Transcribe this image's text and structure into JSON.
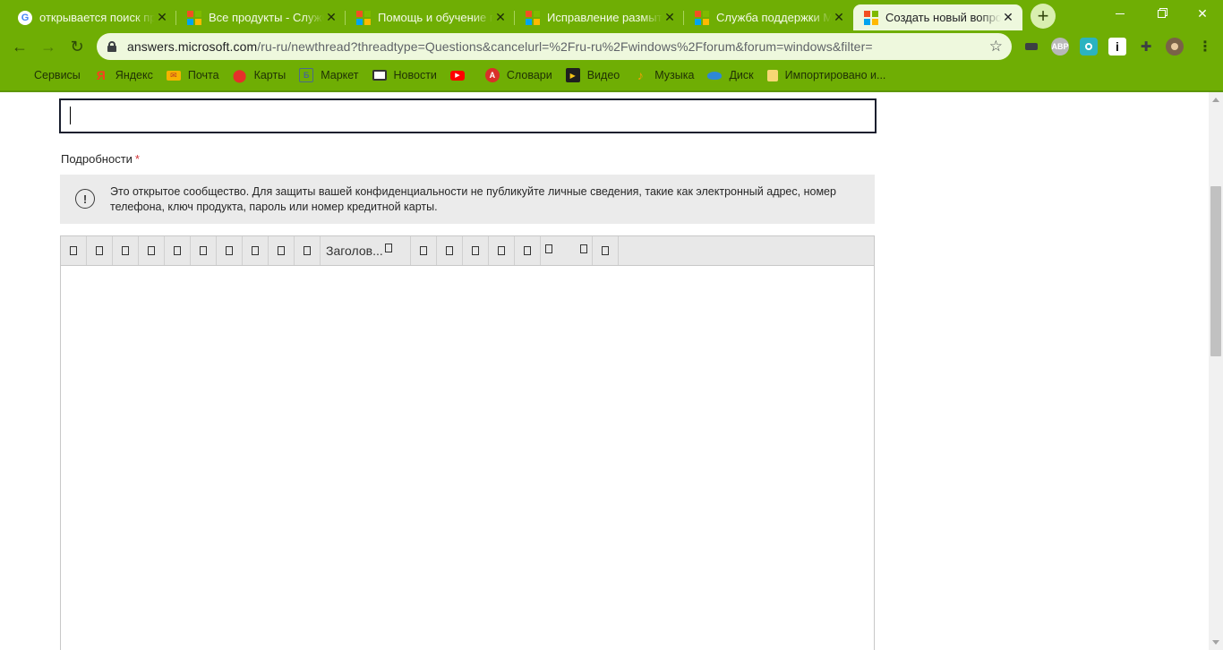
{
  "browser": {
    "tabs": [
      {
        "title": "открывается поиск при",
        "favicon": "google-icon"
      },
      {
        "title": "Все продукты - Служба",
        "favicon": "microsoft-icon"
      },
      {
        "title": "Помощь и обучение по",
        "favicon": "microsoft-icon"
      },
      {
        "title": "Исправление размытого",
        "favicon": "microsoft-icon"
      },
      {
        "title": "Служба поддержки Mic",
        "favicon": "microsoft-icon"
      },
      {
        "title": "Создать новый вопрос",
        "favicon": "microsoft-icon",
        "active": true
      }
    ],
    "url_host": "answers.microsoft.com",
    "url_path": "/ru-ru/newthread?threadtype=Questions&cancelurl=%2Fru-ru%2Fwindows%2Fforum&forum=windows&filter=",
    "extensions": [
      {
        "name": "camera-extension-icon",
        "label": ""
      },
      {
        "name": "adblock-extension-icon",
        "label": "ABP"
      },
      {
        "name": "location-extension-icon",
        "label": ""
      },
      {
        "name": "i-extension-icon",
        "label": "i"
      },
      {
        "name": "puzzle-extensions-icon",
        "label": ""
      },
      {
        "name": "profile-avatar-icon",
        "label": ""
      }
    ],
    "bookmarks": [
      {
        "label": "Сервисы",
        "icon": "apps-grid-icon",
        "color": "#e8453c"
      },
      {
        "label": "Яндекс",
        "icon": "yandex-icon",
        "color": "#fc3f1d"
      },
      {
        "label": "Почта",
        "icon": "mail-icon",
        "color": "#f6b200"
      },
      {
        "label": "Карты",
        "icon": "maps-pin-icon",
        "color": "#e5302a"
      },
      {
        "label": "Маркет",
        "icon": "market-icon",
        "color": "#4a6a8a"
      },
      {
        "label": "Новости",
        "icon": "news-icon",
        "color": "#333333"
      },
      {
        "label": "",
        "icon": "youtube-icon",
        "color": "#ff0000"
      },
      {
        "label": "Словари",
        "icon": "dictionary-icon",
        "color": "#d9302a"
      },
      {
        "label": "Видео",
        "icon": "video-icon",
        "color": "#1f1f1f"
      },
      {
        "label": "Музыка",
        "icon": "music-icon",
        "color": "#f4a100"
      },
      {
        "label": "Диск",
        "icon": "disk-icon",
        "color": "#2e88d6"
      },
      {
        "label": "Импортировано и...",
        "icon": "folder-icon",
        "color": "#f7d774"
      }
    ],
    "theme_color": "#6fae04"
  },
  "form": {
    "title_value": "",
    "details_label": "Подробности",
    "required_mark": "*",
    "notice_text": "Это открытое сообщество. Для защиты вашей конфиденциальности не публикуйте личные сведения, такие как электронный адрес, номер телефона, ключ продукта, пароль или номер кредитной карты.",
    "notice_icon": "info-circle-icon",
    "editor": {
      "format_dropdown_label": "Заголов...",
      "body_text": ""
    }
  }
}
